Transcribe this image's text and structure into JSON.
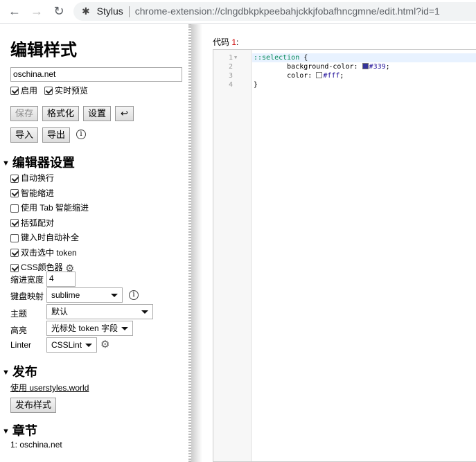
{
  "browser": {
    "site_name": "Stylus",
    "url": "chrome-extension://clngdbkpkpeebahjckkjfobafhncgmne/edit.html?id=1"
  },
  "left": {
    "title": "编辑样式",
    "name_value": "oschina.net",
    "enabled_label": "启用",
    "live_preview_label": "实时预览",
    "buttons": {
      "save": "保存",
      "beautify": "格式化",
      "settings": "设置",
      "back": "↩",
      "import": "导入",
      "export": "导出"
    },
    "editor_settings": {
      "heading": "编辑器设置",
      "options": [
        {
          "label": "自动换行",
          "checked": true
        },
        {
          "label": "智能缩进",
          "checked": true
        },
        {
          "label": "使用 Tab 智能缩进",
          "checked": false
        },
        {
          "label": "括弧配对",
          "checked": true
        },
        {
          "label": "键入时自动补全",
          "checked": false
        },
        {
          "label": "双击选中 token",
          "checked": true
        },
        {
          "label": "CSS颜色器",
          "checked": true
        }
      ],
      "indent_label": "缩进宽度",
      "indent_value": "4",
      "keymap_label": "键盘映射",
      "keymap_value": "sublime",
      "theme_label": "主题",
      "theme_value": "默认",
      "highlight_label": "高亮",
      "highlight_value": "光标处 token 字段",
      "linter_label": "Linter",
      "linter_value": "CSSLint"
    },
    "publish": {
      "heading": "发布",
      "link": "使用 userstyles.world",
      "button": "发布样式"
    },
    "sections": {
      "heading": "章节",
      "item": "1: oschina.net"
    }
  },
  "editor": {
    "label": "代码",
    "label_num": "1",
    ":": ":",
    "lines": [
      "1",
      "2",
      "3",
      "4"
    ],
    "code": {
      "selector": "::selection",
      "brace_open": " {",
      "prop1": "        background-color: ",
      "val1": "#339",
      "prop2": "        color: ",
      "val2": "#fff",
      "brace_close": "}"
    },
    "colors": {
      "swatch1": "#333399",
      "swatch2": "#ffffff"
    }
  }
}
